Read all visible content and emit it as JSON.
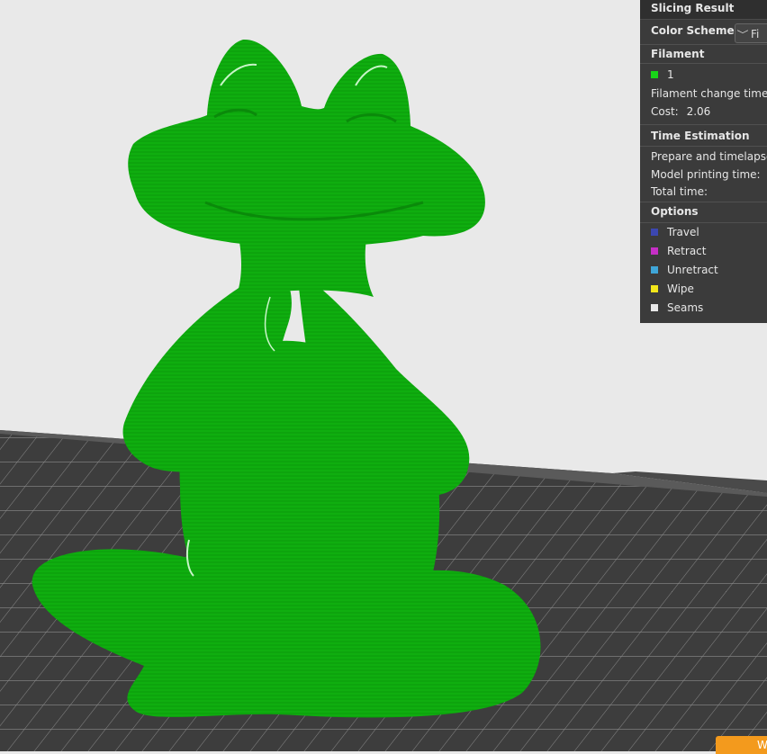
{
  "slicing_result": {
    "title": "Slicing Result",
    "color_scheme_label": "Color Scheme",
    "color_scheme_value": "Fi",
    "filament_header": "Filament",
    "filament_id": "1",
    "filament_color": "#18d418",
    "filament_change_label": "Filament change times",
    "cost_label": "Cost:",
    "cost_value": "2.06",
    "time_header": "Time Estimation",
    "prepare_label": "Prepare and timelapse",
    "model_time_label": "Model printing time:",
    "total_time_label": "Total time:",
    "options_header": "Options",
    "options": [
      {
        "label": "Travel",
        "color": "#3c47b0"
      },
      {
        "label": "Retract",
        "color": "#c62fc6"
      },
      {
        "label": "Unretract",
        "color": "#3fa6d8"
      },
      {
        "label": "Wipe",
        "color": "#f2e61a"
      },
      {
        "label": "Seams",
        "color": "#e8e8e8"
      }
    ]
  },
  "corner_button_label": "W",
  "model": {
    "name": "frog",
    "color": "#0fb30f"
  }
}
